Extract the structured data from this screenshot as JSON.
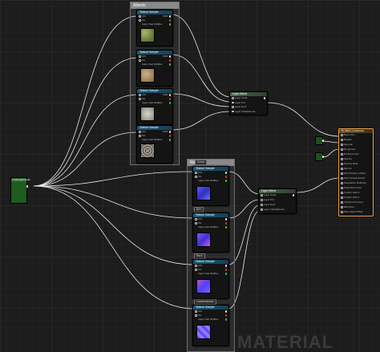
{
  "comments": {
    "albedo": "Albedo",
    "normal": "Normal"
  },
  "texture_sample": {
    "title": "Texture Sample",
    "inputs": [
      "UVs",
      "Tex",
      "Apply View MipBias"
    ],
    "outputs": [
      "RGB",
      "R",
      "G",
      "B",
      "A",
      "RGBA"
    ]
  },
  "landscape_coords": {
    "title": "LandscapeCoords"
  },
  "layer_blend": {
    "title": "Layer Blend",
    "inputs": [
      "Layer Grass",
      "Layer Dirt",
      "Layer Rock",
      "Layer Cobblestones"
    ]
  },
  "layer_blend_normal": {
    "title": "Layer Blend",
    "inputs": [
      "Layer Grass",
      "Layer Dirt",
      "Layer Rock",
      "Layer Cobblestones"
    ]
  },
  "material": {
    "title": "M_TEST_Landscape",
    "inputs": [
      "Base Color",
      "Metallic",
      "Specular",
      "Roughness",
      "Emissive Color",
      "Opacity",
      "Opacity Mask",
      "Normal",
      "World Position Offset",
      "World Displacement",
      "Tessellation Multiplier",
      "Subsurface Color",
      "Custom Data 0",
      "Custom Data 1",
      "Ambient Occlusion",
      "Refraction",
      "Pixel Depth Offset"
    ]
  },
  "normal_tags": [
    "Grass",
    "Dirt",
    "Rock",
    "Cobblestones"
  ],
  "watermark": "MATERIAL",
  "colors": {
    "accent": "#f0a040",
    "wire": "#e8e8e8"
  }
}
